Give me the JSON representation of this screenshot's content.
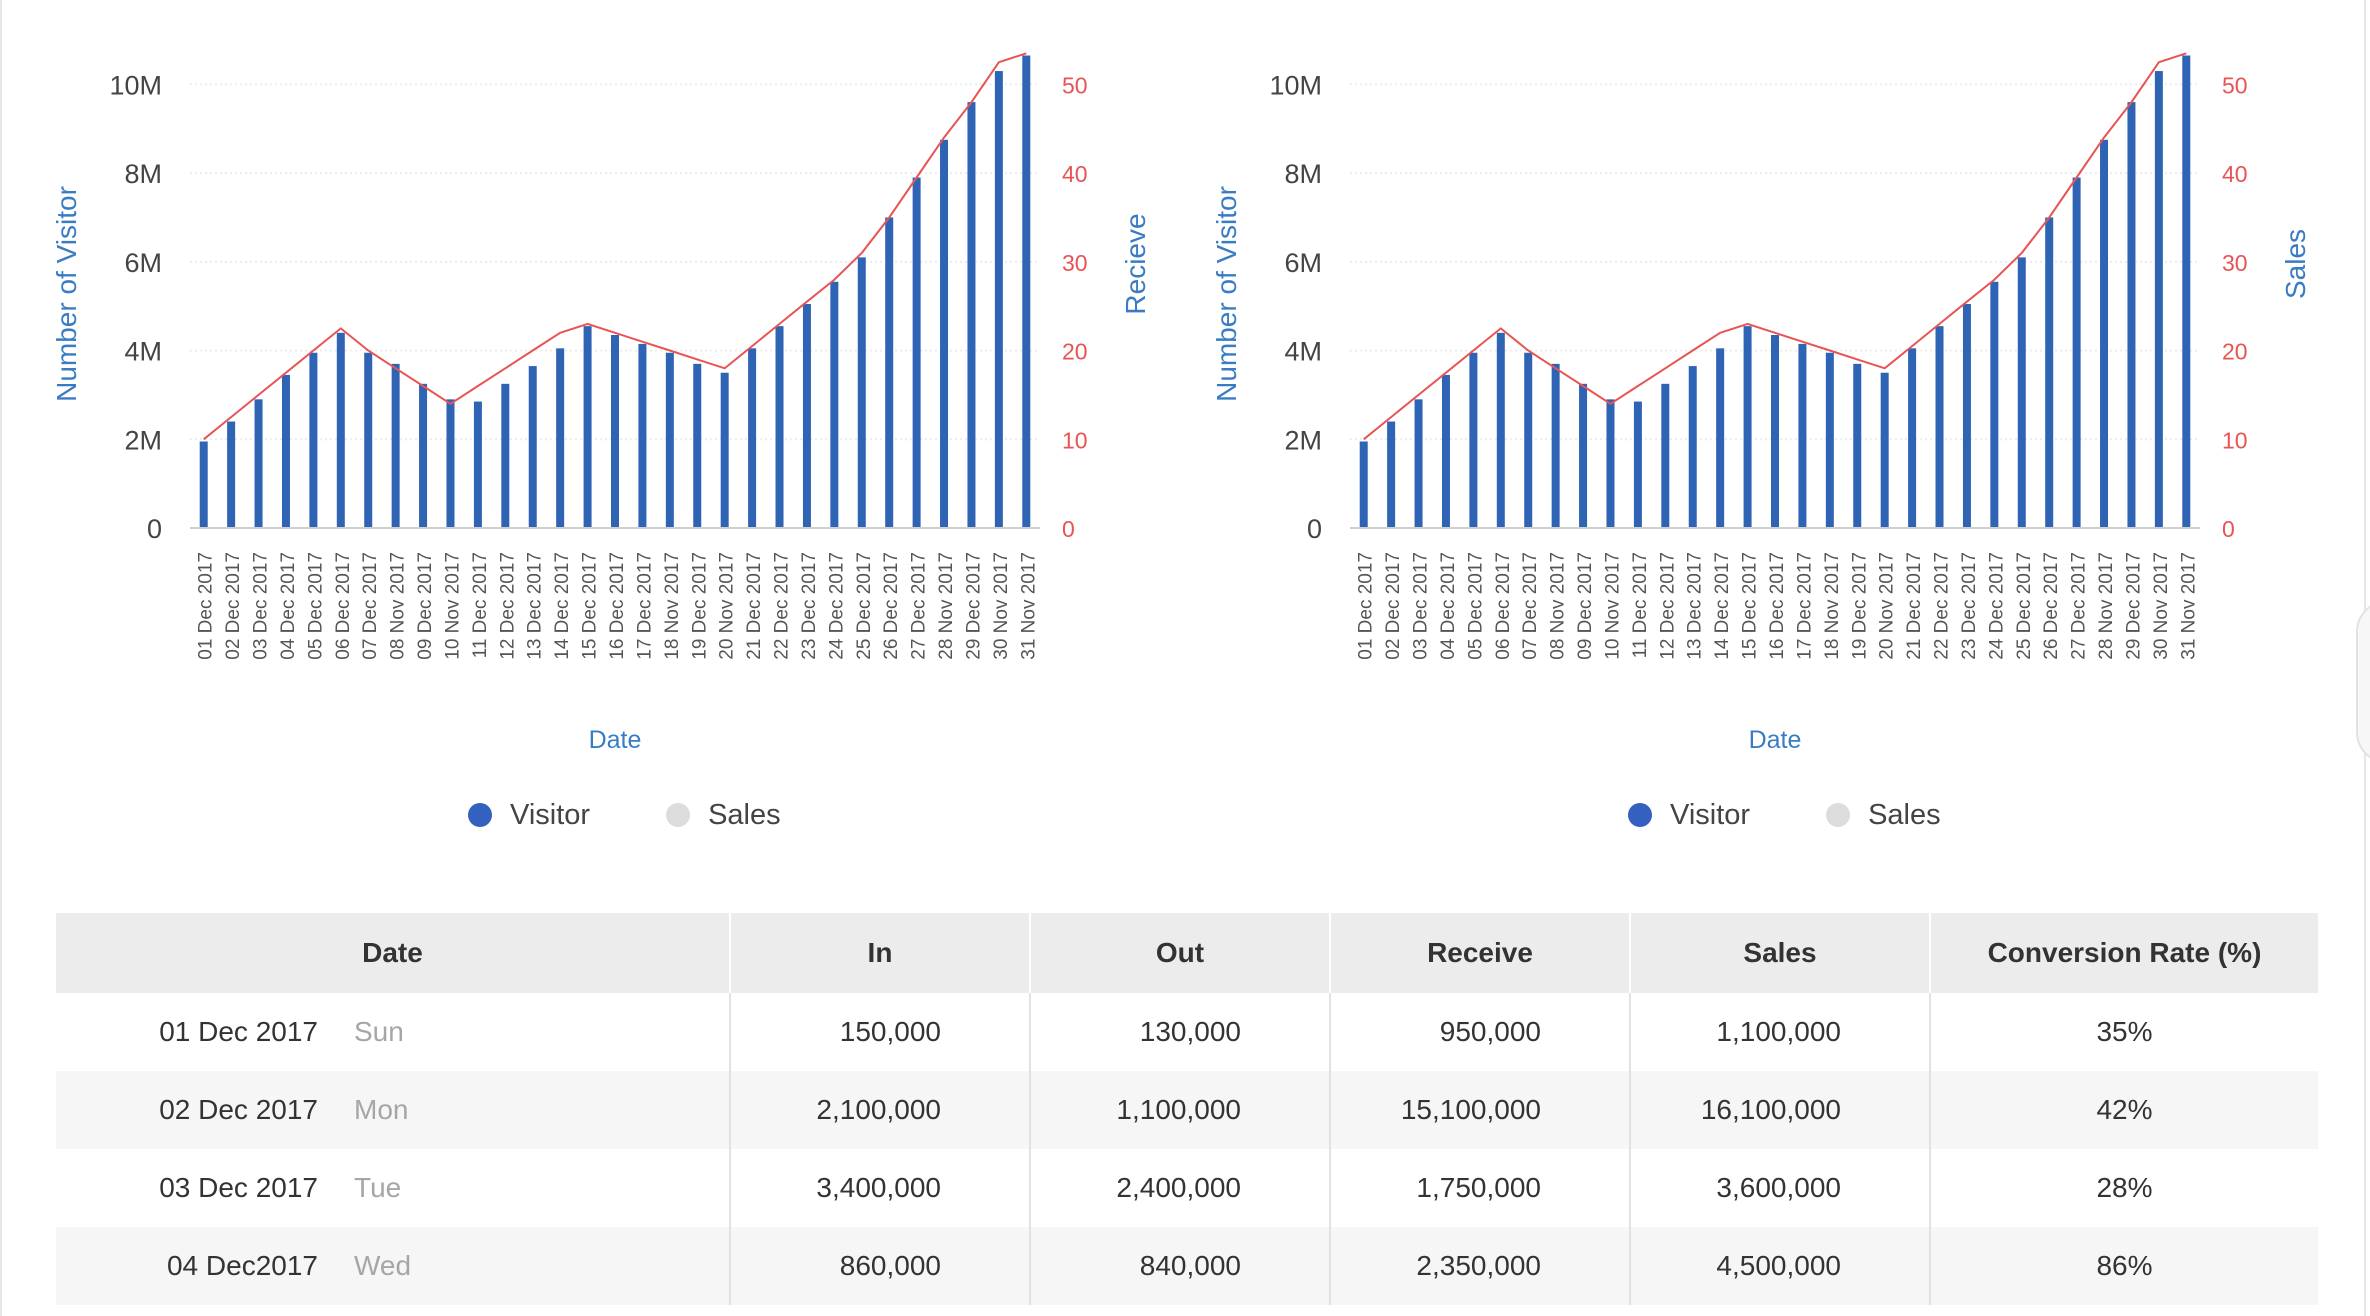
{
  "colors": {
    "bar": "#2f63b3",
    "line": "#e85454",
    "axis_title": "#3a7cc4",
    "grid": "#ececec",
    "legend_visitor": "#3460c0",
    "legend_sales": "#dcdcdc"
  },
  "chart_data": [
    {
      "type": "bar",
      "categories": [
        "01 Dec 2017",
        "02 Dec 2017",
        "03 Dec 2017",
        "04 Dec 2017",
        "05 Dec 2017",
        "06 Dec 2017",
        "07 Dec 2017",
        "08 Nov 2017",
        "09 Dec 2017",
        "10 Nov 2017",
        "11 Dec 2017",
        "12 Dec 2017",
        "13 Dec 2017",
        "14 Dec 2017",
        "15 Dec 2017",
        "16 Dec 2017",
        "17 Dec 2017",
        "18 Nov 2017",
        "19 Dec 2017",
        "20 Nov 2017",
        "21 Dec 2017",
        "22 Dec 2017",
        "23 Dec 2017",
        "24 Dec 2017",
        "25 Dec 2017",
        "26 Dec 2017",
        "27 Dec 2017",
        "28 Nov 2017",
        "29 Dec 2017",
        "30 Nov 2017",
        "31 Nov 2017"
      ],
      "series": [
        {
          "name": "Visitor",
          "axis": "left",
          "values": [
            1.95,
            2.4,
            2.9,
            3.45,
            3.95,
            4.4,
            3.95,
            3.7,
            3.25,
            2.9,
            2.85,
            3.25,
            3.65,
            4.05,
            4.55,
            4.35,
            4.15,
            3.95,
            3.7,
            3.5,
            4.05,
            4.55,
            5.05,
            5.55,
            6.1,
            7.0,
            7.9,
            8.75,
            9.6,
            10.3,
            10.65
          ]
        },
        {
          "name": "Sales",
          "axis": "right",
          "values": [
            10,
            12.5,
            15,
            17.5,
            20,
            22.5,
            20,
            18,
            16,
            14,
            16,
            18,
            20,
            22,
            23,
            22,
            21,
            20,
            19,
            18,
            20.5,
            23,
            25.5,
            28,
            31,
            35,
            39.5,
            44,
            48,
            52.5,
            53.5
          ]
        }
      ],
      "xlabel": "Date",
      "ylabel": "Number of Visitor",
      "y2label": "Recieve",
      "ylim": [
        0,
        11
      ],
      "y2lim": [
        0,
        55
      ],
      "yticks": [
        "0",
        "2M",
        "4M",
        "6M",
        "8M",
        "10M"
      ],
      "ytick_values": [
        0,
        2,
        4,
        6,
        8,
        10
      ],
      "y2ticks": [
        "0",
        "10",
        "20",
        "30",
        "40",
        "50"
      ],
      "y2tick_values": [
        0,
        10,
        20,
        30,
        40,
        50
      ],
      "grid": true,
      "legend": [
        "Visitor",
        "Sales"
      ],
      "legend_position": "bottom"
    },
    {
      "type": "bar",
      "categories": [
        "01 Dec 2017",
        "02 Dec 2017",
        "03 Dec 2017",
        "04 Dec 2017",
        "05 Dec 2017",
        "06 Dec 2017",
        "07 Dec 2017",
        "08 Nov 2017",
        "09 Dec 2017",
        "10 Nov 2017",
        "11 Dec 2017",
        "12 Dec 2017",
        "13 Dec 2017",
        "14 Dec 2017",
        "15 Dec 2017",
        "16 Dec 2017",
        "17 Dec 2017",
        "18 Nov 2017",
        "19 Dec 2017",
        "20 Nov 2017",
        "21 Dec 2017",
        "22 Dec 2017",
        "23 Dec 2017",
        "24 Dec 2017",
        "25 Dec 2017",
        "26 Dec 2017",
        "27 Dec 2017",
        "28 Nov 2017",
        "29 Dec 2017",
        "30 Nov 2017",
        "31 Nov 2017"
      ],
      "series": [
        {
          "name": "Visitor",
          "axis": "left",
          "values": [
            1.95,
            2.4,
            2.9,
            3.45,
            3.95,
            4.4,
            3.95,
            3.7,
            3.25,
            2.9,
            2.85,
            3.25,
            3.65,
            4.05,
            4.55,
            4.35,
            4.15,
            3.95,
            3.7,
            3.5,
            4.05,
            4.55,
            5.05,
            5.55,
            6.1,
            7.0,
            7.9,
            8.75,
            9.6,
            10.3,
            10.65
          ]
        },
        {
          "name": "Sales",
          "axis": "right",
          "values": [
            10,
            12.5,
            15,
            17.5,
            20,
            22.5,
            20,
            18,
            16,
            14,
            16,
            18,
            20,
            22,
            23,
            22,
            21,
            20,
            19,
            18,
            20.5,
            23,
            25.5,
            28,
            31,
            35,
            39.5,
            44,
            48,
            52.5,
            53.5
          ]
        }
      ],
      "xlabel": "Date",
      "ylabel": "Number of Visitor",
      "y2label": "Sales",
      "ylim": [
        0,
        11
      ],
      "y2lim": [
        0,
        55
      ],
      "yticks": [
        "0",
        "2M",
        "4M",
        "6M",
        "8M",
        "10M"
      ],
      "ytick_values": [
        0,
        2,
        4,
        6,
        8,
        10
      ],
      "y2ticks": [
        "0",
        "10",
        "20",
        "30",
        "40",
        "50"
      ],
      "y2tick_values": [
        0,
        10,
        20,
        30,
        40,
        50
      ],
      "grid": true,
      "legend": [
        "Visitor",
        "Sales"
      ],
      "legend_position": "bottom"
    }
  ],
  "table": {
    "headers": [
      "Date",
      "In",
      "Out",
      "Receive",
      "Sales",
      "Conversion Rate (%)"
    ],
    "rows": [
      {
        "date": "01 Dec 2017",
        "dow": "Sun",
        "in": "150,000",
        "out": "130,000",
        "receive": "950,000",
        "sales": "1,100,000",
        "conversion": "35%"
      },
      {
        "date": "02 Dec 2017",
        "dow": "Mon",
        "in": "2,100,000",
        "out": "1,100,000",
        "receive": "15,100,000",
        "sales": "16,100,000",
        "conversion": "42%"
      },
      {
        "date": "03 Dec 2017",
        "dow": "Tue",
        "in": "3,400,000",
        "out": "2,400,000",
        "receive": "1,750,000",
        "sales": "3,600,000",
        "conversion": "28%"
      },
      {
        "date": "04 Dec2017",
        "dow": "Wed",
        "in": "860,000",
        "out": "840,000",
        "receive": "2,350,000",
        "sales": "4,500,000",
        "conversion": "86%"
      }
    ]
  }
}
